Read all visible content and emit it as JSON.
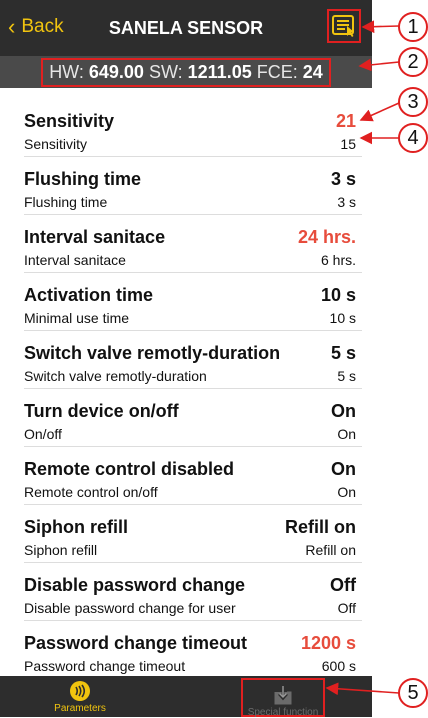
{
  "header": {
    "back_label": "Back",
    "title": "SANELA SENSOR"
  },
  "info": {
    "hw_label": "HW:",
    "hw_value": "649.00",
    "sw_label": "SW:",
    "sw_value": "1211.05",
    "fce_label": "FCE:",
    "fce_value": "24"
  },
  "rows": [
    {
      "label": "Sensitivity",
      "sub": "Sensitivity",
      "value": "21",
      "subvalue": "15",
      "value_red": true
    },
    {
      "label": "Flushing time",
      "sub": "Flushing time",
      "value": "3 s",
      "subvalue": "3 s",
      "value_red": false
    },
    {
      "label": "Interval sanitace",
      "sub": "Interval sanitace",
      "value": "24 hrs.",
      "subvalue": "6 hrs.",
      "value_red": true
    },
    {
      "label": "Activation time",
      "sub": "Minimal use time",
      "value": "10 s",
      "subvalue": "10 s",
      "value_red": false
    },
    {
      "label": "Switch valve remotly-duration",
      "sub": "Switch valve remotly-duration",
      "value": "5 s",
      "subvalue": "5 s",
      "value_red": false
    },
    {
      "label": "Turn device on/off",
      "sub": "On/off",
      "value": "On",
      "subvalue": "On",
      "value_red": false
    },
    {
      "label": "Remote control disabled",
      "sub": "Remote control on/off",
      "value": "On",
      "subvalue": "On",
      "value_red": false
    },
    {
      "label": "Siphon refill",
      "sub": "Siphon refill",
      "value": "Refill on",
      "subvalue": "Refill on",
      "value_red": false
    },
    {
      "label": "Disable password change",
      "sub": "Disable password change for user",
      "value": "Off",
      "subvalue": "Off",
      "value_red": false
    },
    {
      "label": "Password change timeout",
      "sub": "Password change timeout",
      "value": "1200 s",
      "subvalue": "600 s",
      "value_red": true
    }
  ],
  "tabs": [
    {
      "label": "Parameters",
      "icon": "nfc-icon"
    },
    {
      "label": "Special function",
      "icon": "download-icon"
    }
  ],
  "callouts": [
    "1",
    "2",
    "3",
    "4",
    "5"
  ],
  "colors": {
    "accent": "#f1c40f",
    "highlight_red": "#e74c3c",
    "annotation_red": "#e02020",
    "header_bg": "#2d2d2d"
  }
}
